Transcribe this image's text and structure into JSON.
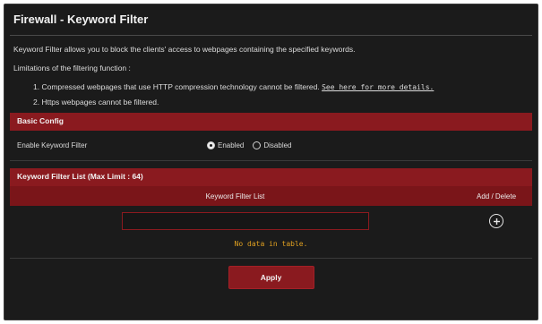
{
  "page": {
    "title": "Firewall - Keyword Filter"
  },
  "description": {
    "intro": "Keyword Filter allows you to block the clients' access to webpages containing the specified keywords.",
    "limitations_heading": "Limitations of the filtering function :",
    "limitations": [
      {
        "text": "1. Compressed webpages that use HTTP compression technology cannot be filtered.",
        "link": "See here for more details."
      },
      {
        "text": "2. Https webpages cannot be filtered."
      }
    ]
  },
  "basic_config": {
    "header": "Basic Config",
    "enable_label": "Enable Keyword Filter",
    "options": [
      {
        "label": "Enabled",
        "checked": true
      },
      {
        "label": "Disabled",
        "checked": false
      }
    ]
  },
  "keyword_list": {
    "header": "Keyword Filter List (Max Limit : 64)",
    "columns": {
      "list": "Keyword Filter List",
      "action": "Add / Delete"
    },
    "input_value": "",
    "add_icon": "plus-circle-icon",
    "empty_text": "No data in table."
  },
  "actions": {
    "apply_label": "Apply"
  },
  "colors": {
    "accent": "#8a1a1f",
    "background": "#1b1b1b",
    "empty_text": "#e0a020"
  }
}
